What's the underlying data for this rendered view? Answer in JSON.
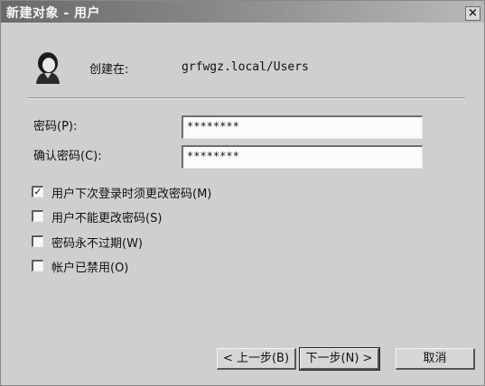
{
  "window": {
    "title": "新建对象 - 用户",
    "close_symbol": "×"
  },
  "header": {
    "created_in_label": "创建在:",
    "created_in_value": "grfwgz.local/Users"
  },
  "fields": {
    "password": {
      "label": "密码(P):",
      "value": "********"
    },
    "confirm_password": {
      "label": "确认密码(C):",
      "value": "********"
    }
  },
  "options": [
    {
      "label": "用户下次登录时须更改密码(M)",
      "checked": true,
      "mark": "✓"
    },
    {
      "label": "用户不能更改密码(S)",
      "checked": false,
      "mark": ""
    },
    {
      "label": "密码永不过期(W)",
      "checked": false,
      "mark": ""
    },
    {
      "label": "帐户已禁用(O)",
      "checked": false,
      "mark": ""
    }
  ],
  "buttons": {
    "back": "< 上一步(B)",
    "next": "下一步(N) >",
    "cancel": "取消"
  }
}
